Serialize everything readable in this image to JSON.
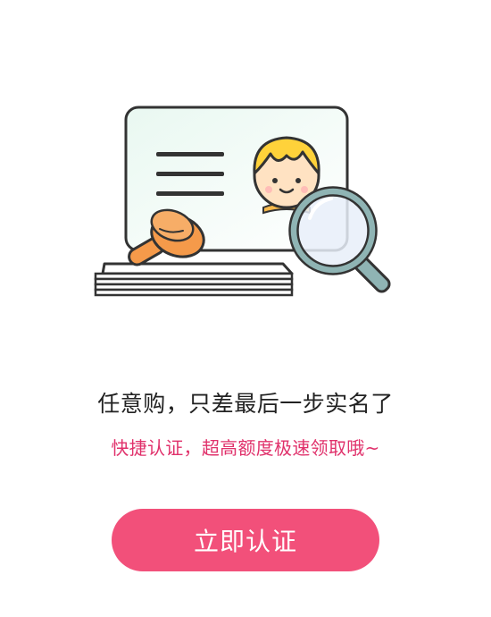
{
  "dialog": {
    "illustration_icon": "id-card-verification-icon",
    "headline": "任意购，只差最后一步实名了",
    "subline": "快捷认证，超高额度极速领取哦~",
    "cta_label": "立即认证"
  },
  "colors": {
    "accent": "#f2507a",
    "subline_text": "#e0316b",
    "headline_text": "#222222",
    "card_fill": "#e8f7f2",
    "stamp_orange": "#f59a4a",
    "magnifier_rim": "#8fb4b4",
    "hair_yellow": "#ffd23a"
  }
}
